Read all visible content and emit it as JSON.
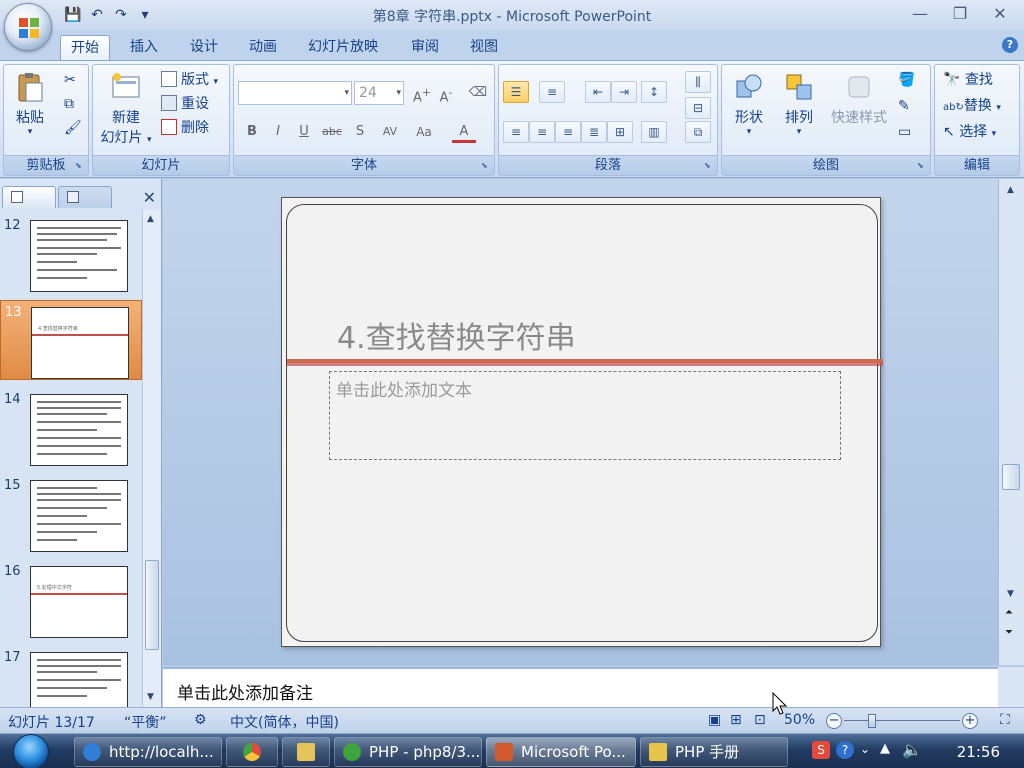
{
  "window": {
    "title": "第8章 字符串.pptx - Microsoft PowerPoint"
  },
  "tabs": [
    "开始",
    "插入",
    "设计",
    "动画",
    "幻灯片放映",
    "审阅",
    "视图"
  ],
  "ribbon": {
    "clipboard": {
      "label": "剪贴板",
      "paste": "粘贴"
    },
    "slides": {
      "label": "幻灯片",
      "new_slide_1": "新建",
      "new_slide_2": "幻灯片",
      "layout": "版式",
      "reset": "重设",
      "delete": "删除"
    },
    "font": {
      "label": "字体",
      "font_name": "",
      "font_size": "24"
    },
    "paragraph": {
      "label": "段落"
    },
    "drawing": {
      "label": "绘图",
      "shapes": "形状",
      "arrange": "排列",
      "quick_styles": "快速样式"
    },
    "editing": {
      "label": "编辑",
      "find": "查找",
      "replace": "替换",
      "select": "选择"
    }
  },
  "thumbnails": [
    {
      "num": "12",
      "type": "text"
    },
    {
      "num": "13",
      "type": "title",
      "title": "4.查找替换字符串",
      "selected": true
    },
    {
      "num": "14",
      "type": "text"
    },
    {
      "num": "15",
      "type": "text"
    },
    {
      "num": "16",
      "type": "title",
      "title": "5.处理中文字符"
    },
    {
      "num": "17",
      "type": "text"
    }
  ],
  "slide": {
    "title": "4.查找替换字符串",
    "body_placeholder": "单击此处添加文本"
  },
  "notes": {
    "placeholder": "单击此处添加备注"
  },
  "status": {
    "slide_pos": "幻灯片 13/17",
    "theme": "“平衡”",
    "language": "中文(简体，中国)",
    "zoom": "50%"
  },
  "taskbar": {
    "items": [
      {
        "label": "http://localh...",
        "color": "#2f7fd6"
      },
      {
        "label": "",
        "color": "#e24a3b"
      },
      {
        "label": "",
        "color": "#e4c35a"
      },
      {
        "label": "PHP - php8/3...",
        "color": "#3fa33f"
      },
      {
        "label": "Microsoft Po...",
        "color": "#d2592d"
      },
      {
        "label": "PHP 手册",
        "color": "#e8c34a"
      }
    ],
    "clock": "21:56"
  },
  "colors": {
    "accent_rule": "#c0504d",
    "selected_thumb": "#e08b45"
  }
}
